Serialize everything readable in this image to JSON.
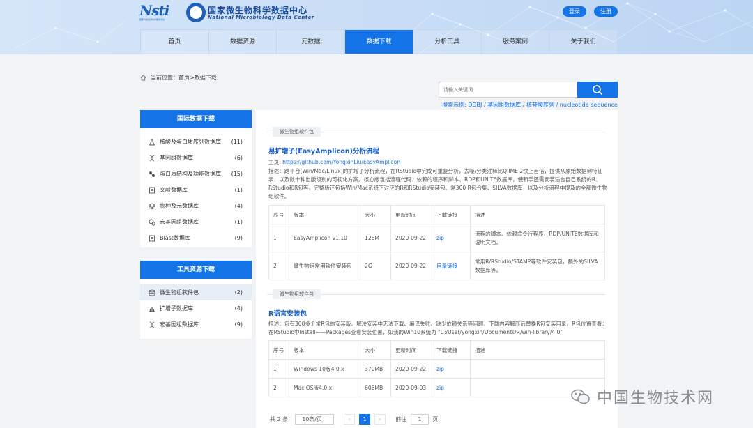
{
  "header": {
    "logo_text": "Nsti",
    "logo_sub": "国家科技资源共享服务平台",
    "title": "国家微生物科学数据中心",
    "subtitle": "National Microbiology Data Center",
    "login": "登录",
    "register": "注册"
  },
  "nav": [
    "首页",
    "数据资源",
    "元数据",
    "数据下载",
    "分析工具",
    "服务案例",
    "关于我们"
  ],
  "breadcrumb": "当前位置：首页>数据下载",
  "search": {
    "placeholder": "请输入关键词",
    "examples": "搜索示例: DDBJ / 基因组数据库 / 核苷酸序列 / nucleotide sequence"
  },
  "sidebar": {
    "intl": {
      "title": "国际数据下载",
      "items": [
        {
          "label": "核酸及蛋白质序列数据库",
          "count": "(11)"
        },
        {
          "label": "基因组数据库",
          "count": "(6)"
        },
        {
          "label": "蛋白质结构及功能数据库",
          "count": "(15)"
        },
        {
          "label": "文献数据库",
          "count": "(1)"
        },
        {
          "label": "物种及元数据库",
          "count": "(4)"
        },
        {
          "label": "宏基因组数据库",
          "count": "(1)"
        },
        {
          "label": "Blast数据库",
          "count": "(9)"
        }
      ]
    },
    "tools": {
      "title": "工具资源下载",
      "items": [
        {
          "label": "微生物组软件包",
          "count": "(2)"
        },
        {
          "label": "扩增子数据库",
          "count": "(4)"
        },
        {
          "label": "宏基因组数据库",
          "count": "(9)"
        }
      ]
    }
  },
  "sec1": {
    "tag": "微生物组软件包",
    "title": "易扩增子(EasyAmplicon)分析流程",
    "home_label": "主页:",
    "home_url": "https://github.com/YongxinLiu/EasyAmplicon",
    "desc": "描述：跨平台(Win/Mac/Linux)的扩增子分析流程，在RStudio中完成可重复分析，去噪/分类注释比QIIME 2快上百倍，提供从原始数据到特征表，以及数十种出版级别的可视化方案。核心版包括流程代码、依赖的程序和脚本、RDP和UNITE数据库，使新手还需安装适合自己系统的R、RStudio和R包等。完整版还包括Win/Mac系统下对应的R和RStudio安装包、常300 R包合集、SILVA数据库，以及分析流程中提及的全部微生物组软件。",
    "headers": [
      "序号",
      "版本",
      "大小",
      "更新时间",
      "下载链接",
      "描述"
    ],
    "rows": [
      [
        "1",
        "EasyAmplicon v1.10",
        "128M",
        "2020-09-22",
        "zip",
        "流程的脚本、依赖命令行程序、RDP/UNITE数据库和说明文档。"
      ],
      [
        "2",
        "微生物组常用软件安装包",
        "2G",
        "2020-09-22",
        "目录链接",
        "常用R/RStudio/STAMP等软件安装包，额外的SILVA数据库等。"
      ]
    ]
  },
  "sec2": {
    "tag": "微生物组软件包",
    "title": "R语言安装包",
    "desc": "描述：包有300多个常R包的安装版。解决安装中无法下载、编译失败、缺少依赖关系等问题。下载内容解压后替换R包安装目录。R包位置查看：在RStudio中Install——Packages查看安装位置，如我的Win10系统为 \"C:/User/yongxin/Documents/R/win-library/4.0\"",
    "headers": [
      "序号",
      "版本",
      "大小",
      "更新时间",
      "下载链接",
      "描述"
    ],
    "rows": [
      [
        "1",
        "Windows 10版4.0.x",
        "370MB",
        "2020-09-22",
        "zip",
        ""
      ],
      [
        "2",
        "Mac OS版4.0.x",
        "606MB",
        "2020-09-03",
        "zip",
        ""
      ]
    ]
  },
  "pager": {
    "total": "共 2 条",
    "size": "10条/页",
    "page": "1",
    "goto": "前往",
    "goto_val": "1",
    "page_unit": "页"
  },
  "watermark": "中国生物技术网"
}
